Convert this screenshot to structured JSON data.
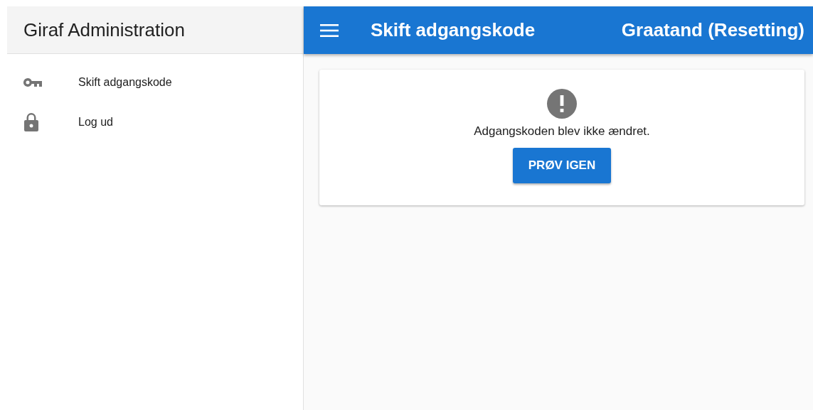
{
  "sidebar": {
    "title": "Giraf Administration",
    "items": [
      {
        "label": "Skift adgangskode",
        "kind": "key"
      },
      {
        "label": "Log ud",
        "kind": "lock"
      }
    ]
  },
  "app_bar": {
    "title": "Skift adgangskode",
    "user": "Graatand (Resetting)"
  },
  "message_card": {
    "message": "Adgangskoden blev ikke ændret.",
    "button": "PRØV IGEN"
  }
}
